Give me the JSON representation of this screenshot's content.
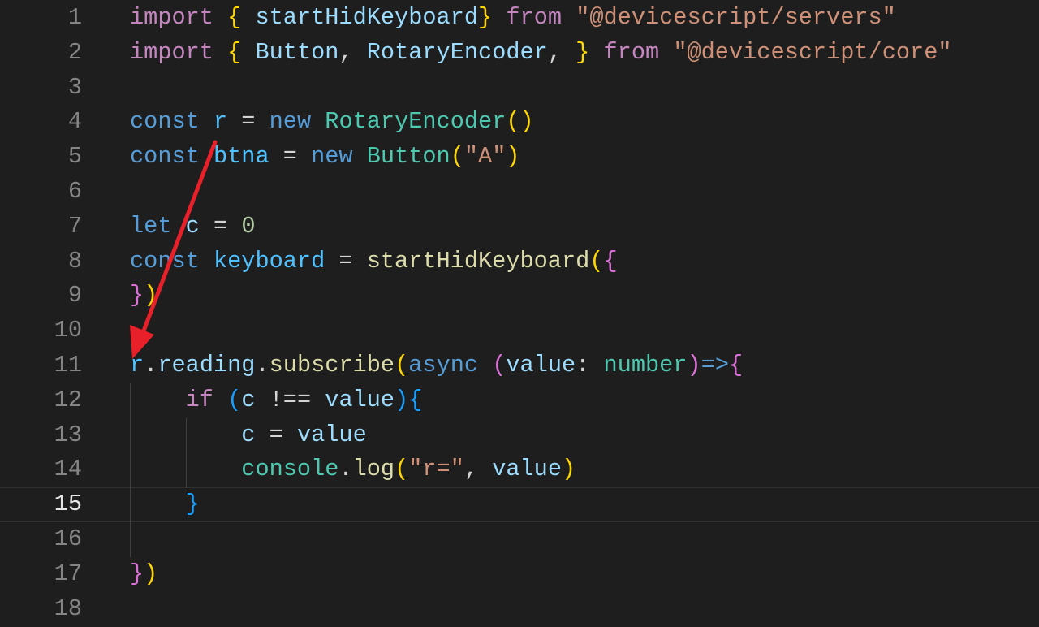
{
  "colors": {
    "kw": "#c586c0",
    "storage": "#569cd6",
    "var": "#9cdcfe",
    "const": "#4fc1ff",
    "fn": "#dcdcaa",
    "cls": "#4ec9b0",
    "str": "#ce9178",
    "num": "#b5cea8",
    "b1": "#ffd700",
    "b2": "#da70d6",
    "b3": "#179fff",
    "plain": "#d4d4d4",
    "arrow": "#e8202a"
  },
  "active_line": 15,
  "lines": [
    {
      "n": "1",
      "tokens": [
        {
          "t": "import",
          "k": "kw"
        },
        {
          "t": " ",
          "k": "plain"
        },
        {
          "t": "{",
          "k": "b1"
        },
        {
          "t": " startHidKeyboard",
          "k": "var"
        },
        {
          "t": "}",
          "k": "b1"
        },
        {
          "t": " ",
          "k": "plain"
        },
        {
          "t": "from",
          "k": "kw"
        },
        {
          "t": " ",
          "k": "plain"
        },
        {
          "t": "\"@devicescript/servers\"",
          "k": "str"
        }
      ]
    },
    {
      "n": "2",
      "tokens": [
        {
          "t": "import",
          "k": "kw"
        },
        {
          "t": " ",
          "k": "plain"
        },
        {
          "t": "{",
          "k": "b1"
        },
        {
          "t": " Button",
          "k": "var"
        },
        {
          "t": ", ",
          "k": "plain"
        },
        {
          "t": "RotaryEncoder",
          "k": "var"
        },
        {
          "t": ", ",
          "k": "plain"
        },
        {
          "t": "}",
          "k": "b1"
        },
        {
          "t": " ",
          "k": "plain"
        },
        {
          "t": "from",
          "k": "kw"
        },
        {
          "t": " ",
          "k": "plain"
        },
        {
          "t": "\"@devicescript/core\"",
          "k": "str"
        }
      ]
    },
    {
      "n": "3",
      "tokens": []
    },
    {
      "n": "4",
      "tokens": [
        {
          "t": "const",
          "k": "storage"
        },
        {
          "t": " ",
          "k": "plain"
        },
        {
          "t": "r",
          "k": "const"
        },
        {
          "t": " = ",
          "k": "plain"
        },
        {
          "t": "new",
          "k": "storage"
        },
        {
          "t": " ",
          "k": "plain"
        },
        {
          "t": "RotaryEncoder",
          "k": "cls"
        },
        {
          "t": "()",
          "k": "b1"
        }
      ]
    },
    {
      "n": "5",
      "tokens": [
        {
          "t": "const",
          "k": "storage"
        },
        {
          "t": " ",
          "k": "plain"
        },
        {
          "t": "btna",
          "k": "const"
        },
        {
          "t": " = ",
          "k": "plain"
        },
        {
          "t": "new",
          "k": "storage"
        },
        {
          "t": " ",
          "k": "plain"
        },
        {
          "t": "Button",
          "k": "cls"
        },
        {
          "t": "(",
          "k": "b1"
        },
        {
          "t": "\"A\"",
          "k": "str"
        },
        {
          "t": ")",
          "k": "b1"
        }
      ]
    },
    {
      "n": "6",
      "tokens": []
    },
    {
      "n": "7",
      "tokens": [
        {
          "t": "let",
          "k": "storage"
        },
        {
          "t": " ",
          "k": "plain"
        },
        {
          "t": "c",
          "k": "var"
        },
        {
          "t": " = ",
          "k": "plain"
        },
        {
          "t": "0",
          "k": "num"
        }
      ]
    },
    {
      "n": "8",
      "tokens": [
        {
          "t": "const",
          "k": "storage"
        },
        {
          "t": " ",
          "k": "plain"
        },
        {
          "t": "keyboard",
          "k": "const"
        },
        {
          "t": " = ",
          "k": "plain"
        },
        {
          "t": "startHidKeyboard",
          "k": "fn"
        },
        {
          "t": "(",
          "k": "b1"
        },
        {
          "t": "{",
          "k": "b2"
        }
      ]
    },
    {
      "n": "9",
      "tokens": [
        {
          "t": "}",
          "k": "b2"
        },
        {
          "t": ")",
          "k": "b1"
        }
      ]
    },
    {
      "n": "10",
      "tokens": []
    },
    {
      "n": "11",
      "tokens": [
        {
          "t": "r",
          "k": "const"
        },
        {
          "t": ".",
          "k": "plain"
        },
        {
          "t": "reading",
          "k": "var"
        },
        {
          "t": ".",
          "k": "plain"
        },
        {
          "t": "subscribe",
          "k": "fn"
        },
        {
          "t": "(",
          "k": "b1"
        },
        {
          "t": "async",
          "k": "storage"
        },
        {
          "t": " ",
          "k": "plain"
        },
        {
          "t": "(",
          "k": "b2"
        },
        {
          "t": "value",
          "k": "var"
        },
        {
          "t": ": ",
          "k": "plain"
        },
        {
          "t": "number",
          "k": "cls"
        },
        {
          "t": ")",
          "k": "b2"
        },
        {
          "t": "=>",
          "k": "storage"
        },
        {
          "t": "{",
          "k": "b2"
        }
      ]
    },
    {
      "n": "12",
      "tokens": [
        {
          "t": "    ",
          "k": "plain"
        },
        {
          "t": "if",
          "k": "kw"
        },
        {
          "t": " ",
          "k": "plain"
        },
        {
          "t": "(",
          "k": "b3"
        },
        {
          "t": "c",
          "k": "var"
        },
        {
          "t": " !== ",
          "k": "plain"
        },
        {
          "t": "value",
          "k": "var"
        },
        {
          "t": ")",
          "k": "b3"
        },
        {
          "t": "{",
          "k": "b3"
        }
      ]
    },
    {
      "n": "13",
      "tokens": [
        {
          "t": "        ",
          "k": "plain"
        },
        {
          "t": "c",
          "k": "var"
        },
        {
          "t": " = ",
          "k": "plain"
        },
        {
          "t": "value",
          "k": "var"
        }
      ]
    },
    {
      "n": "14",
      "tokens": [
        {
          "t": "        ",
          "k": "plain"
        },
        {
          "t": "console",
          "k": "cls"
        },
        {
          "t": ".",
          "k": "plain"
        },
        {
          "t": "log",
          "k": "fn"
        },
        {
          "t": "(",
          "k": "b1"
        },
        {
          "t": "\"r=\"",
          "k": "str"
        },
        {
          "t": ", ",
          "k": "plain"
        },
        {
          "t": "value",
          "k": "var"
        },
        {
          "t": ")",
          "k": "b1"
        }
      ]
    },
    {
      "n": "15",
      "tokens": [
        {
          "t": "    ",
          "k": "plain"
        },
        {
          "t": "}",
          "k": "b3"
        }
      ]
    },
    {
      "n": "16",
      "tokens": []
    },
    {
      "n": "17",
      "tokens": [
        {
          "t": "}",
          "k": "b2"
        },
        {
          "t": ")",
          "k": "b1"
        }
      ]
    },
    {
      "n": "18",
      "tokens": []
    }
  ]
}
